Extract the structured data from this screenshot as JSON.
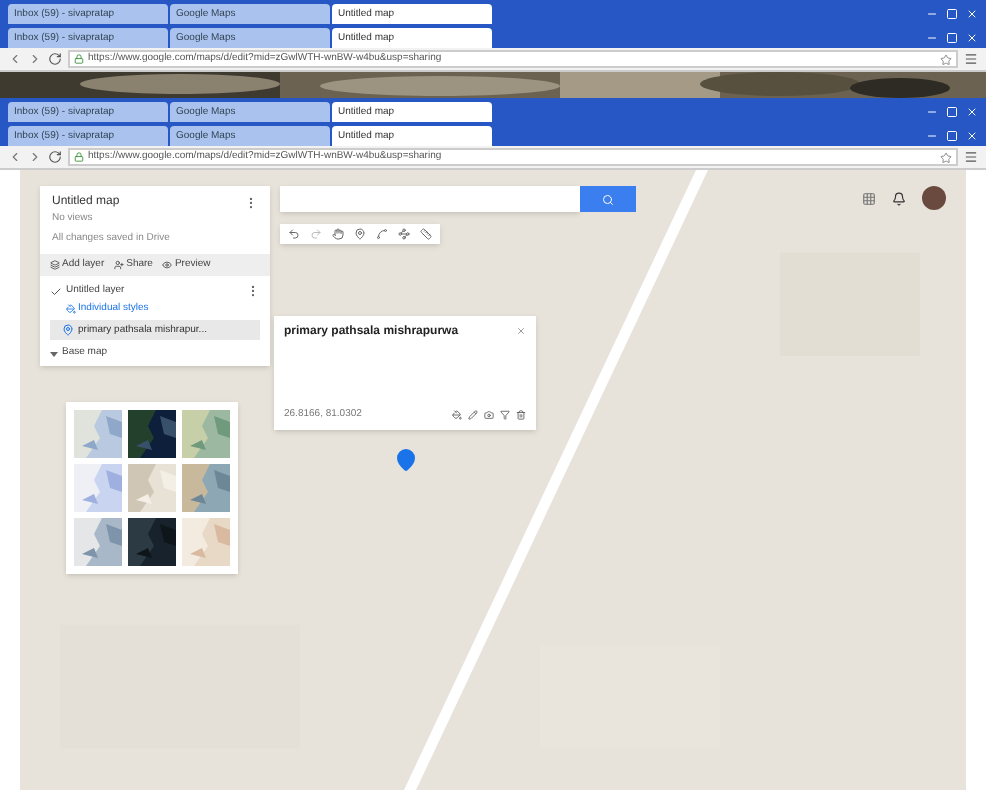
{
  "browser_strips": [
    {
      "kind": "tabs",
      "tabs": [
        {
          "title": "Inbox (59) - sivapratap",
          "selected": false
        },
        {
          "title": "Google Maps",
          "selected": false
        },
        {
          "title": "Untitled map",
          "selected": true
        }
      ]
    },
    {
      "kind": "tabs",
      "tabs": [
        {
          "title": "Inbox (59) - sivapratap",
          "selected": false
        },
        {
          "title": "Google Maps",
          "selected": false
        },
        {
          "title": "Untitled map",
          "selected": true
        }
      ]
    },
    {
      "kind": "address",
      "url": "https://www.google.com/maps/d/edit?mid=zGwlWTH-wnBW-w4bu&usp=sharing"
    },
    {
      "kind": "picture"
    },
    {
      "kind": "tabs",
      "tabs": [
        {
          "title": "Inbox (59) - sivapratap",
          "selected": false
        },
        {
          "title": "Google Maps",
          "selected": false
        },
        {
          "title": "Untitled map",
          "selected": true
        }
      ]
    },
    {
      "kind": "tabs",
      "tabs": [
        {
          "title": "Inbox (59) - sivapratap",
          "selected": false
        },
        {
          "title": "Google Maps",
          "selected": false
        },
        {
          "title": "Untitled map",
          "selected": true
        }
      ]
    },
    {
      "kind": "address",
      "url": "https://www.google.com/maps/d/edit?mid=zGwlWTH-wnBW-w4bu&usp=sharing"
    }
  ],
  "map_panel": {
    "title": "Untitled map",
    "subtitle": "No views",
    "save_status": "All changes saved in Drive",
    "actions": [
      {
        "label": "Add layer"
      },
      {
        "label": "Share"
      },
      {
        "label": "Preview"
      }
    ],
    "layer": {
      "name": "Untitled layer",
      "checked": true,
      "style": "Individual styles",
      "items": [
        {
          "label": "primary pathsala mishrapur...",
          "selected": true
        }
      ]
    },
    "base_map": {
      "label": "Base map",
      "expanded": true,
      "styles": [
        {
          "kind": "picture"
        },
        {
          "kind": "picture"
        },
        {
          "kind": "picture"
        },
        {
          "kind": "picture"
        },
        {
          "kind": "picture"
        },
        {
          "kind": "picture"
        },
        {
          "kind": "picture"
        },
        {
          "kind": "picture"
        },
        {
          "kind": "picture"
        }
      ]
    }
  },
  "info_card": {
    "title": "primary pathsala mishrapurwa",
    "coords": "26.8166, 81.0302"
  }
}
